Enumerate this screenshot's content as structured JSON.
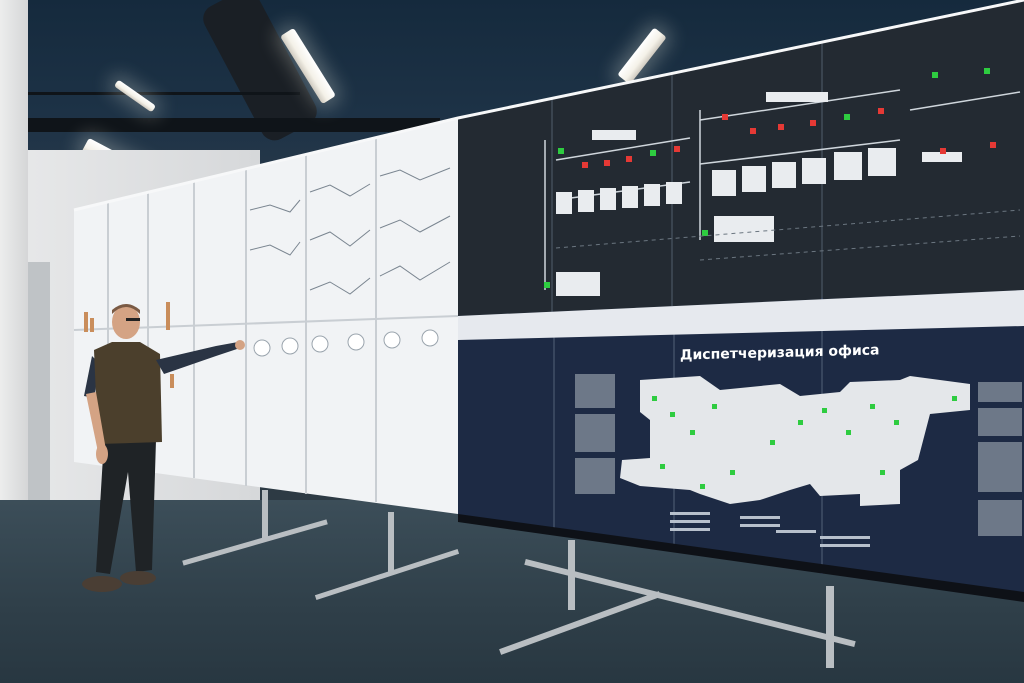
{
  "screen_title": "Диспетчеризация офиса",
  "colors": {
    "ceiling": "#1d3246",
    "panel_light": "#f1f3f5",
    "panel_dark": "#232a32",
    "panel_navy": "#1d2a44",
    "status_green": "#2ecc40",
    "status_red": "#e53935"
  }
}
